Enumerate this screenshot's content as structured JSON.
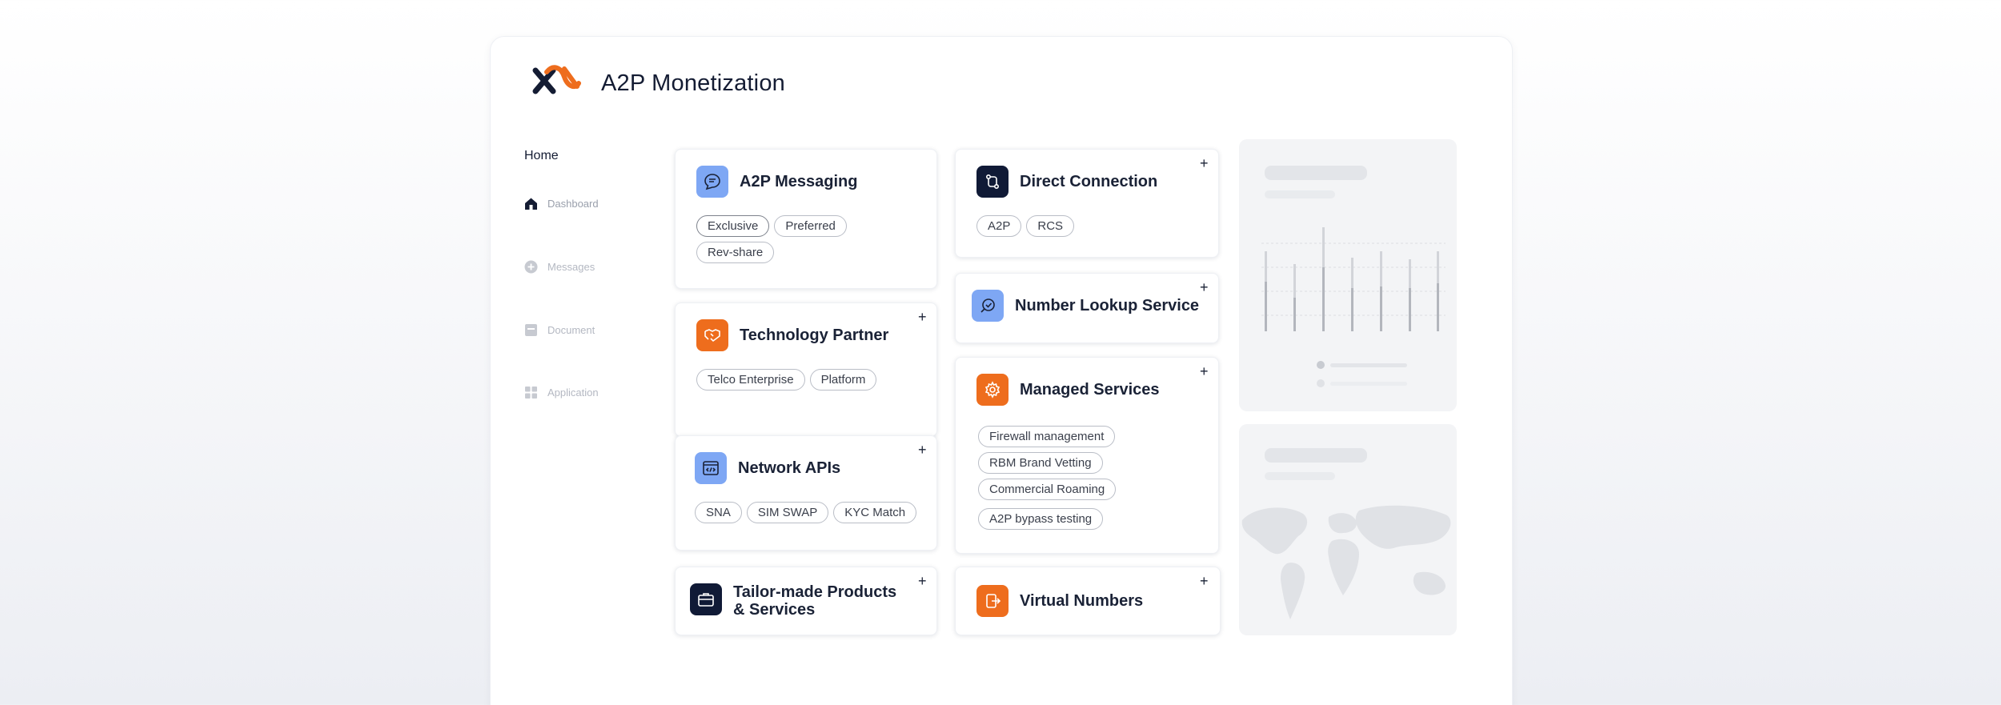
{
  "app": {
    "title": "A2P Monetization"
  },
  "sidebar": {
    "home": "Home",
    "items": [
      {
        "label": "Dashboard",
        "icon": "home-icon"
      },
      {
        "label": "Messages",
        "icon": "plus-circle-icon"
      },
      {
        "label": "Document",
        "icon": "document-icon"
      },
      {
        "label": "Application",
        "icon": "grid-icon"
      }
    ]
  },
  "cards": {
    "a2p_messaging": {
      "title": "A2P Messaging",
      "icon": "chat-icon",
      "tags": [
        "Exclusive",
        "Preferred",
        "Rev-share"
      ]
    },
    "technology_partner": {
      "title": "Technology Partner",
      "icon": "handshake-icon",
      "tags": [
        "Telco Enterprise",
        "Platform"
      ]
    },
    "network_apis": {
      "title": "Network APIs",
      "icon": "code-icon",
      "tags": [
        "SNA",
        "SIM SWAP",
        "KYC Match"
      ]
    },
    "tailor_made": {
      "title_line1": "Tailor-made Products",
      "title_line2": "& Services",
      "icon": "briefcase-icon"
    },
    "direct_connection": {
      "title": "Direct Connection",
      "icon": "connection-icon",
      "tags": [
        "A2P",
        "RCS"
      ]
    },
    "number_lookup": {
      "title": "Number Lookup Service",
      "icon": "search-check-icon"
    },
    "managed_services": {
      "title": "Managed Services",
      "icon": "gear-icon",
      "tags": [
        "Firewall management",
        "RBM Brand Vetting",
        "Commercial Roaming",
        "A2P bypass testing"
      ]
    },
    "virtual_numbers": {
      "title": "Virtual Numbers",
      "icon": "phone-forward-icon"
    }
  },
  "plus_label": "+",
  "colors": {
    "accent_orange": "#ee6d1d",
    "accent_blue": "#7ea7f4",
    "navy": "#101a36"
  }
}
